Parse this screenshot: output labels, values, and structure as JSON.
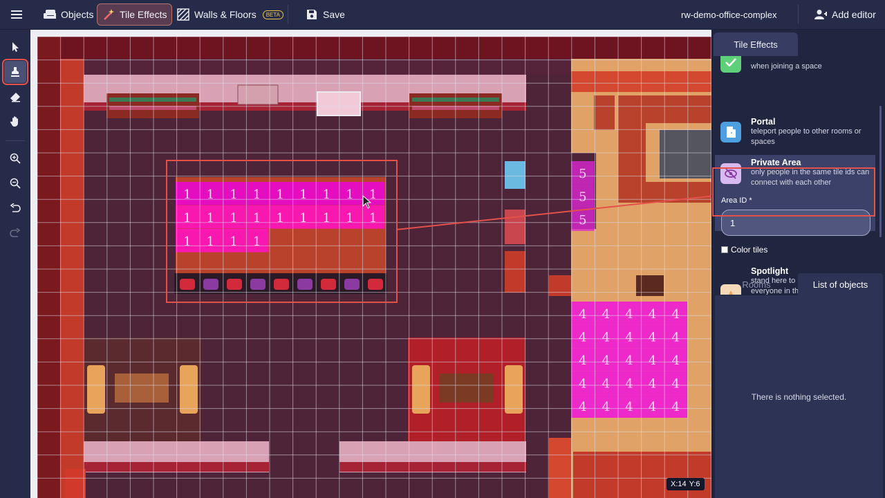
{
  "topbar": {
    "menu_icon": "hamburger-icon",
    "items": [
      {
        "label": "Objects",
        "icon": "sofa-icon"
      },
      {
        "label": "Tile Effects",
        "icon": "magic-wand-icon",
        "active": true
      },
      {
        "label": "Walls & Floors",
        "icon": "hatch-pattern-icon",
        "badge": "BETA"
      },
      {
        "label": "Save",
        "icon": "floppy-disk-icon"
      }
    ],
    "space_name": "rw-demo-office-complex",
    "add_editor_label": "Add editor"
  },
  "left_toolbar": [
    {
      "name": "select",
      "icon": "cursor-arrow-icon"
    },
    {
      "name": "stamp",
      "icon": "stamp-icon",
      "active": true
    },
    {
      "name": "eraser",
      "icon": "eraser-icon"
    },
    {
      "name": "pan",
      "icon": "hand-icon"
    },
    {
      "name": "zoom-in",
      "icon": "zoom-in-icon"
    },
    {
      "name": "zoom-out",
      "icon": "zoom-out-icon"
    },
    {
      "name": "undo",
      "icon": "undo-icon"
    },
    {
      "name": "redo",
      "icon": "redo-icon",
      "disabled": true
    }
  ],
  "map": {
    "tile_labels": {
      "area1": "1",
      "area5": "5",
      "area4": "4"
    },
    "cursor": {
      "x_label": "X:14",
      "y_label": "Y:6"
    }
  },
  "panel": {
    "tab_label": "Tile Effects",
    "effects": [
      {
        "title": "",
        "desc": "when joining a space",
        "icon": "check-icon",
        "color": "#5fd07a"
      },
      {
        "title": "Portal",
        "desc": "teleport people to other rooms or spaces",
        "icon": "door-icon",
        "color": "#4e9fe0"
      },
      {
        "title": "Private Area",
        "desc": "only people in the same tile ids can connect with each other",
        "icon": "eye-off-icon",
        "color": "#d8b9f0",
        "selected": true
      },
      {
        "title": "Spotlight",
        "desc": "stand here to be heard and seen by everyone in the Room",
        "icon": "spotlight-icon",
        "color": "#f5d9b8"
      }
    ],
    "area_id": {
      "label": "Area ID *",
      "value": "1"
    },
    "color_tiles_label": "Color tiles",
    "bottom_tabs": {
      "rooms": "Rooms",
      "objects": "List of objects"
    },
    "empty_text": "There is nothing selected."
  },
  "colors": {
    "accent_red": "#e4514b",
    "private_area": "#ff1fc8",
    "panel_bg": "#202540"
  }
}
